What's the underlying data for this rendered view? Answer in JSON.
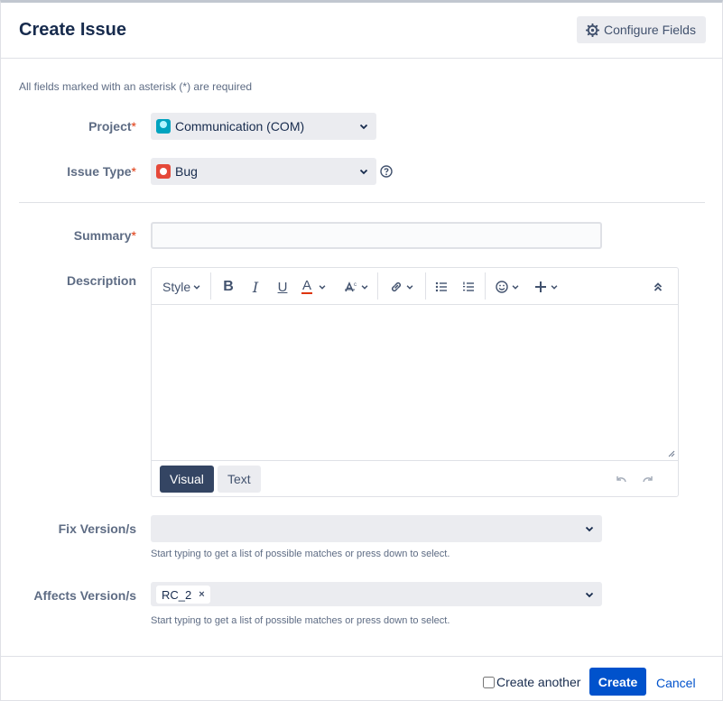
{
  "dialog": {
    "title": "Create Issue",
    "configure_fields_label": "Configure Fields",
    "required_note": "All fields marked with an asterisk (*) are required"
  },
  "fields": {
    "project": {
      "label": "Project",
      "required_mark": "*",
      "value": "Communication (COM)",
      "icon": "project-avatar-icon"
    },
    "issue_type": {
      "label": "Issue Type",
      "required_mark": "*",
      "value": "Bug",
      "icon": "bug-icon"
    },
    "summary": {
      "label": "Summary",
      "required_mark": "*",
      "value": ""
    },
    "description": {
      "label": "Description",
      "toolbar": {
        "style_label": "Style",
        "buttons": [
          "bold-icon",
          "italic-icon",
          "underline-icon",
          "text-color-icon",
          "text-effects-icon",
          "link-icon",
          "bullet-list-icon",
          "numbered-list-icon",
          "emoji-icon",
          "insert-more-icon",
          "collapse-toolbar-icon"
        ]
      },
      "modes": {
        "visual": "Visual",
        "text": "Text",
        "active": "Visual"
      }
    },
    "fix_versions": {
      "label": "Fix Version/s",
      "hint": "Start typing to get a list of possible matches or press down to select."
    },
    "affects_versions": {
      "label": "Affects Version/s",
      "tags": [
        "RC_2"
      ],
      "remove_symbol": "×",
      "hint": "Start typing to get a list of possible matches or press down to select."
    }
  },
  "footer": {
    "create_another_label": "Create another",
    "create_another_checked": false,
    "create_label": "Create",
    "cancel_label": "Cancel"
  },
  "colors": {
    "primary": "#0052cc",
    "required": "#de350b",
    "visual_active": "#344563",
    "field_bg": "#ebecf0"
  }
}
